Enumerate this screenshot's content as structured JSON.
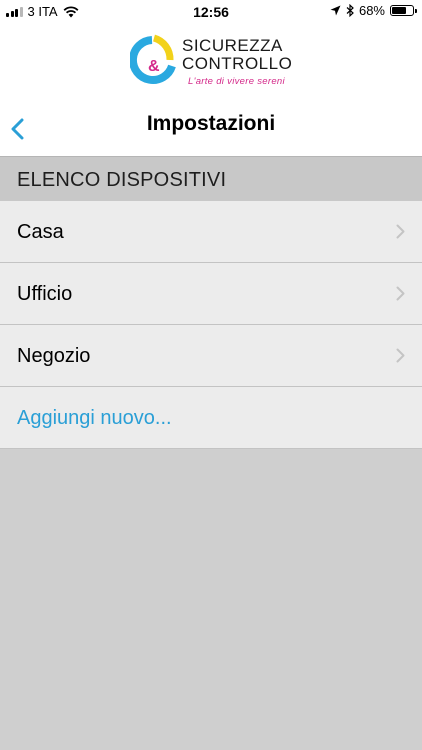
{
  "status_bar": {
    "carrier": "3 ITA",
    "time": "12:56",
    "battery_percent": "68%",
    "battery_level": 0.68,
    "icons": [
      "signal-icon",
      "wifi-icon",
      "location-arrow-icon",
      "bluetooth-icon",
      "battery-icon"
    ]
  },
  "logo": {
    "line1": "SICUREZZA",
    "line2": "CONTROLLO",
    "ampersand": "&",
    "tagline": "L'arte di vivere sereni",
    "colors": {
      "cyan": "#2aa9e0",
      "yellow": "#f2d21a",
      "magenta": "#d42a8a"
    }
  },
  "nav": {
    "title": "Impostazioni",
    "back_icon": "chevron-left-icon"
  },
  "section": {
    "header": "ELENCO DISPOSITIVI"
  },
  "devices": [
    {
      "label": "Casa"
    },
    {
      "label": "Ufficio"
    },
    {
      "label": "Negozio"
    }
  ],
  "add_new": {
    "label": "Aggiungi nuovo..."
  },
  "colors": {
    "accent": "#2a9fd6",
    "row_bg": "#ececec",
    "section_bg": "#c8c8c8",
    "page_bg": "#cfcfcf"
  }
}
